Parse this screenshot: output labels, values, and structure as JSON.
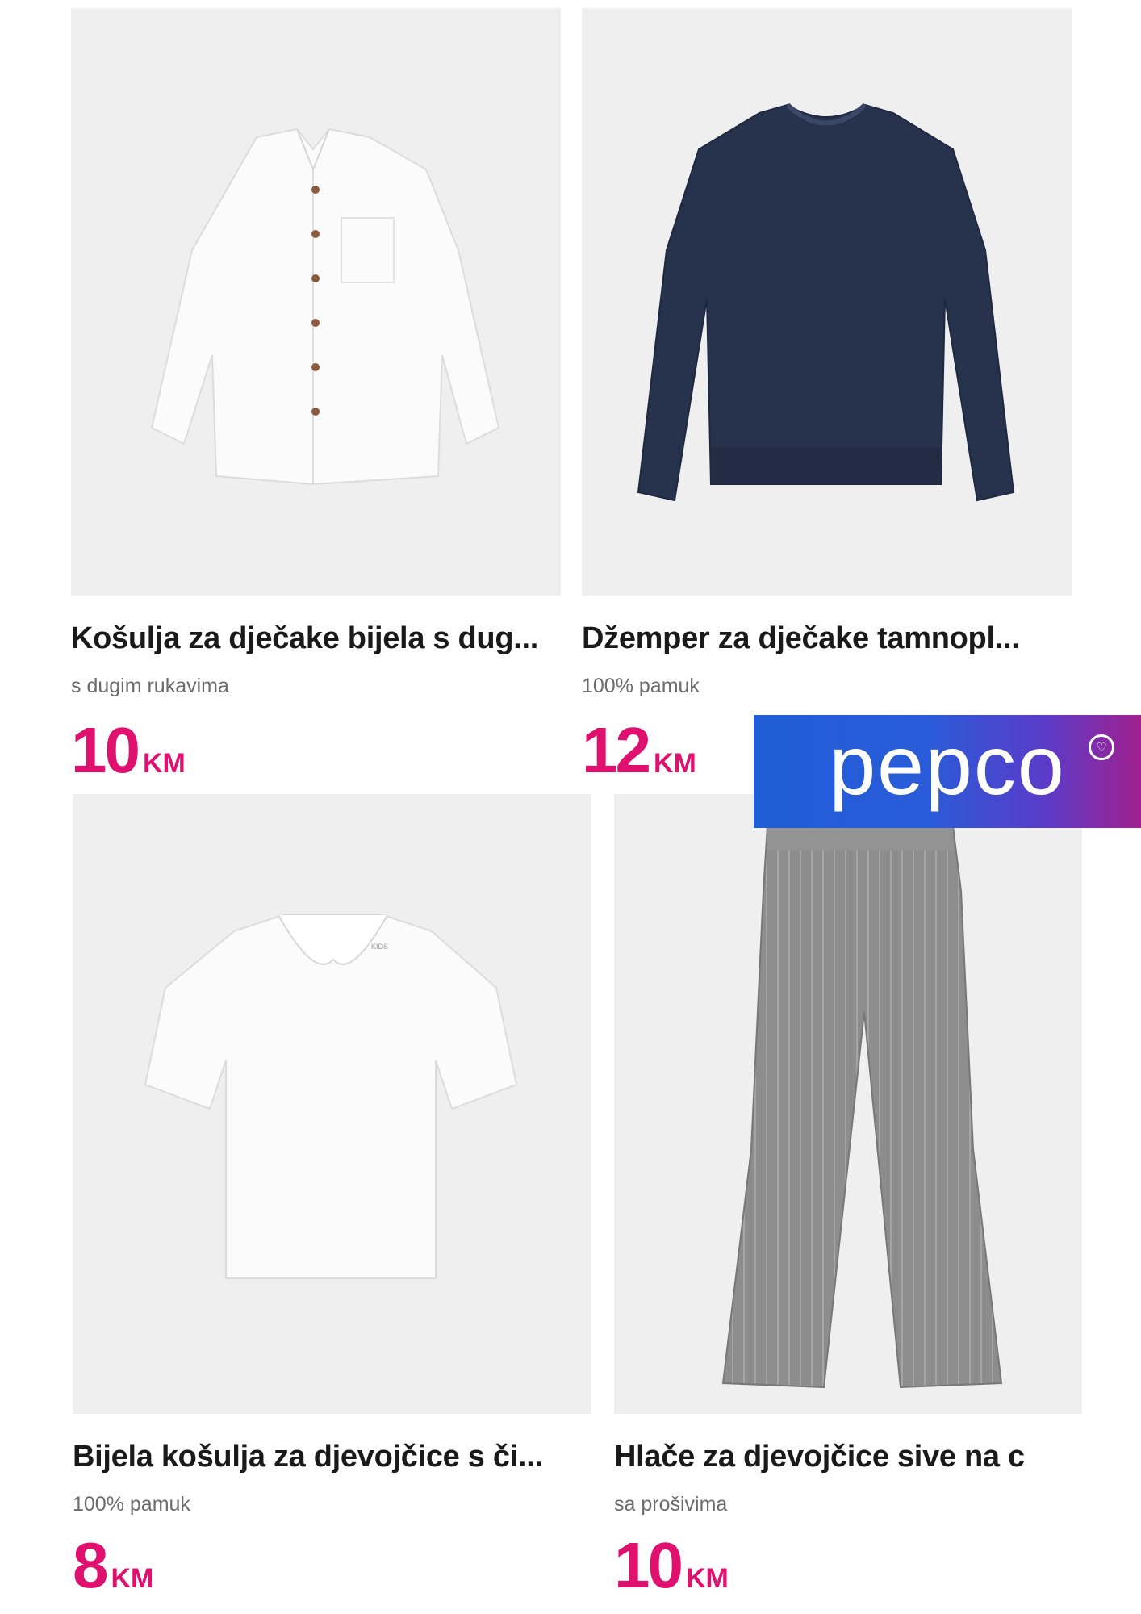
{
  "brand": {
    "logo_text": "pepco"
  },
  "products": [
    {
      "title": "Košulja za dječake bijela s dug...",
      "subtitle": "s dugim rukavima",
      "price": "10",
      "currency": "KM",
      "image": "white-shirt-long-sleeve"
    },
    {
      "title": "Džemper za dječake tamnopl...",
      "subtitle": "100% pamuk",
      "price": "12",
      "currency": "KM",
      "image": "navy-sweater"
    },
    {
      "title": "Bijela košulja za djevojčice s či...",
      "subtitle": "100% pamuk",
      "price": "8",
      "currency": "KM",
      "image": "white-blouse-short-sleeve"
    },
    {
      "title": "Hlače za djevojčice sive na c",
      "subtitle": "sa prošivima",
      "price": "10",
      "currency": "KM",
      "image": "grey-pinstripe-trousers"
    }
  ],
  "colors": {
    "price": "#e0106e",
    "image_bg": "#efefef",
    "logo_start": "#1f5ed6",
    "logo_end": "#a0208f"
  }
}
